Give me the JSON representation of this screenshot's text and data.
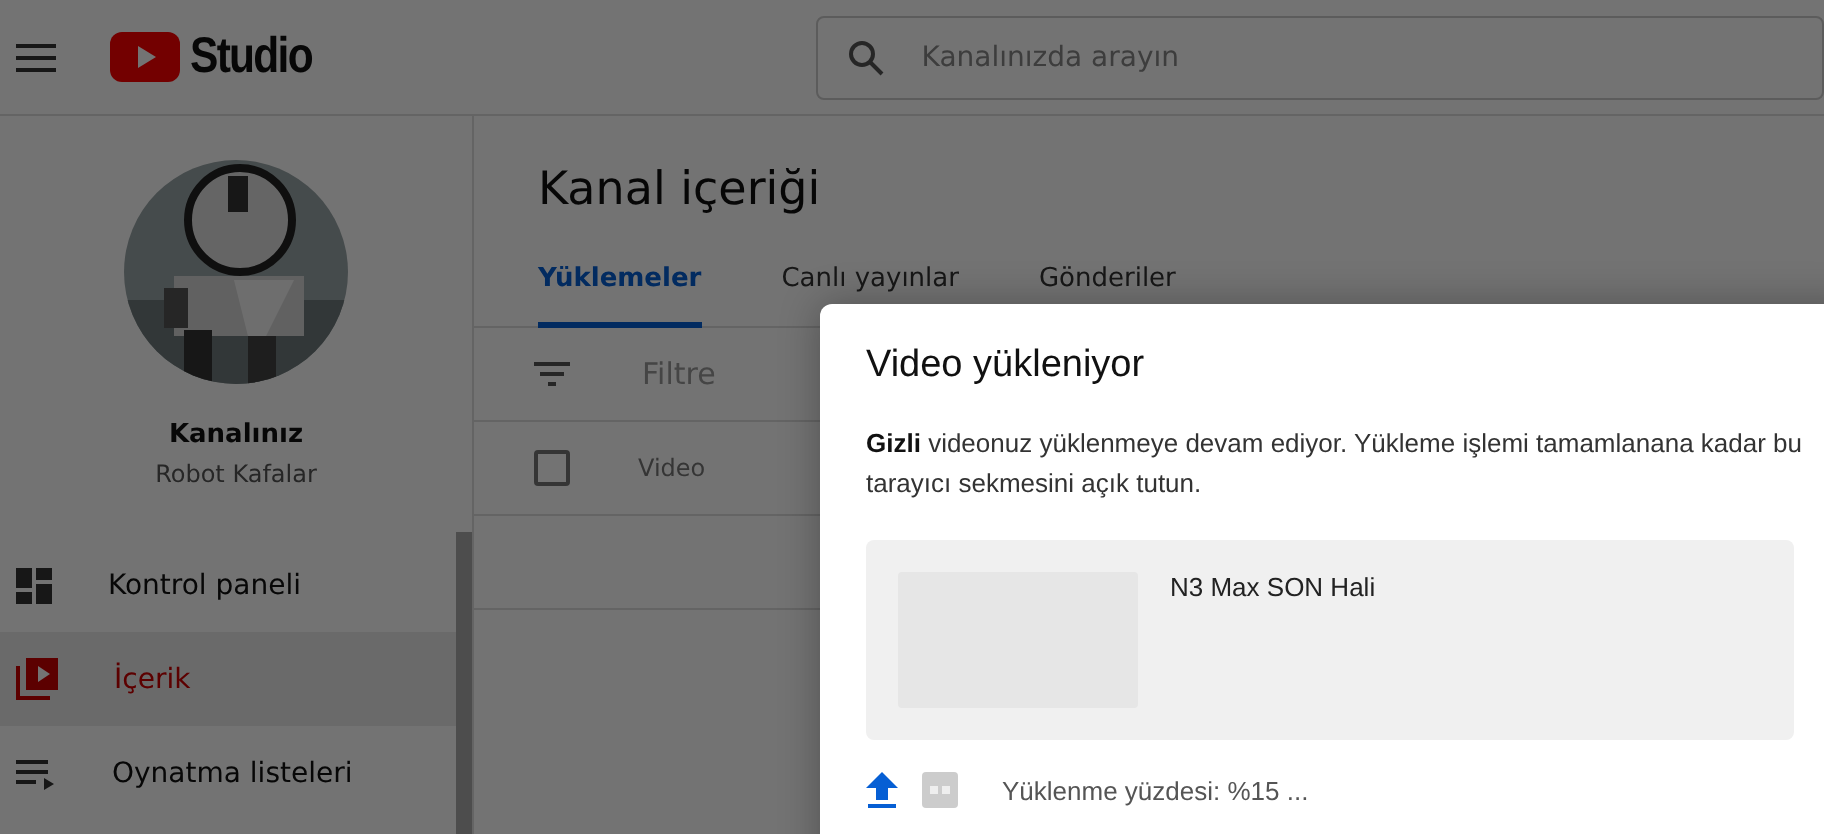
{
  "header": {
    "logo_text": "Studio",
    "search": {
      "placeholder": "Kanalınızda arayın"
    }
  },
  "sidebar": {
    "channel_label": "Kanalınız",
    "channel_name": "Robot Kafalar",
    "items": [
      {
        "kind": "dashboard",
        "label": "Kontrol paneli",
        "selected": false
      },
      {
        "kind": "content",
        "label": "İçerik",
        "selected": true
      },
      {
        "kind": "playlists",
        "label": "Oynatma listeleri",
        "selected": false
      }
    ]
  },
  "page": {
    "title": "Kanal içeriği",
    "tabs": [
      {
        "label": "Yüklemeler",
        "selected": true
      },
      {
        "label": "Canlı yayınlar",
        "selected": false
      },
      {
        "label": "Gönderiler",
        "selected": false
      }
    ],
    "filter": {
      "placeholder": "Filtre"
    },
    "table": {
      "select_all": {
        "checked": false
      },
      "columns": [
        "Video"
      ]
    }
  },
  "dialog": {
    "title": "Video yükleniyor",
    "message": "**Gizli** videonuz yüklenmeye devam ediyor. Yükleme işlemi tamamlanana kadar bu tarayıcı sekmesini açık tutun.",
    "video_title": "N3 Max SON Hali",
    "status": "Yüklenme yüzdesi: %15 ..."
  }
}
